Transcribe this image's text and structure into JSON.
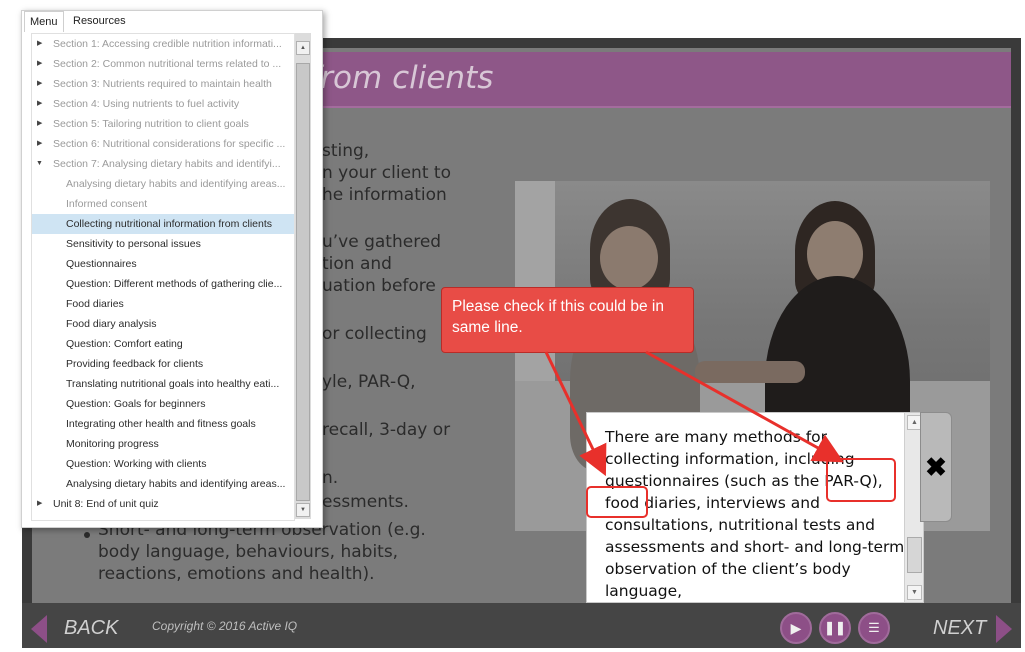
{
  "slide": {
    "title": "onal information from clients",
    "body_lines": [
      "sting,",
      "n your client to",
      "he information",
      "u’ve gathered",
      "tion and",
      "uation before",
      "or collecting",
      "yle, PAR-Q,",
      "recall, 3-day or",
      "n.",
      "essments.",
      "Short- and long-term observation (e.g.",
      "body language, behaviours, habits,",
      "reactions, emotions and health)."
    ]
  },
  "menu": {
    "tabs": [
      "Menu",
      "Resources"
    ],
    "items": [
      {
        "label": "Section 1: Accessing credible nutrition informati...",
        "level": 1
      },
      {
        "label": "Section 2: Common nutritional terms related to ...",
        "level": 1
      },
      {
        "label": "Section 3: Nutrients required to maintain health",
        "level": 1
      },
      {
        "label": "Section 4: Using nutrients to fuel activity",
        "level": 1
      },
      {
        "label": "Section 5: Tailoring nutrition to client goals",
        "level": 1
      },
      {
        "label": "Section 6: Nutritional considerations for specific ...",
        "level": 1
      },
      {
        "label": "Section 7: Analysing dietary habits and identifyi...",
        "level": 1
      },
      {
        "label": "Analysing dietary habits and identifying areas...",
        "level": 2
      },
      {
        "label": "Informed consent",
        "level": 2
      },
      {
        "label": "Collecting nutritional information from clients",
        "level": 2
      },
      {
        "label": "Sensitivity to personal issues",
        "level": 2
      },
      {
        "label": "Questionnaires",
        "level": 2
      },
      {
        "label": "Question: Different methods of gathering clie...",
        "level": 2
      },
      {
        "label": "Food diaries",
        "level": 2
      },
      {
        "label": "Food diary analysis",
        "level": 2
      },
      {
        "label": "Question: Comfort eating",
        "level": 2
      },
      {
        "label": "Providing feedback for clients",
        "level": 2
      },
      {
        "label": "Translating nutritional goals into healthy eati...",
        "level": 2
      },
      {
        "label": "Question: Goals for beginners",
        "level": 2
      },
      {
        "label": "Integrating other health and fitness goals",
        "level": 2
      },
      {
        "label": "Monitoring progress",
        "level": 2
      },
      {
        "label": "Question: Working with clients",
        "level": 2
      },
      {
        "label": "Analysing dietary habits and identifying areas...",
        "level": 2
      },
      {
        "label": "Unit 8: End of unit quiz",
        "level": 1
      }
    ]
  },
  "popup": {
    "text": "There are many methods for collecting information, including questionnaires (such as the PAR-Q), food diaries, interviews and consultations, nutritional tests and assessments and short- and long-term observation of the client’s body language,"
  },
  "annotation": {
    "text": "Please check if this could be in same line."
  },
  "footer": {
    "back_label": "BACK",
    "next_label": "NEXT",
    "copyright": "Copyright © 2016 Active IQ"
  },
  "colors": {
    "accent": "#8d4f87",
    "annotation_red": "#e84c46",
    "menu_selected": "#cfe4f3"
  },
  "icons": {
    "close": "close-icon",
    "play": "play-icon",
    "pause": "pause-icon",
    "transcript": "transcript-icon"
  }
}
